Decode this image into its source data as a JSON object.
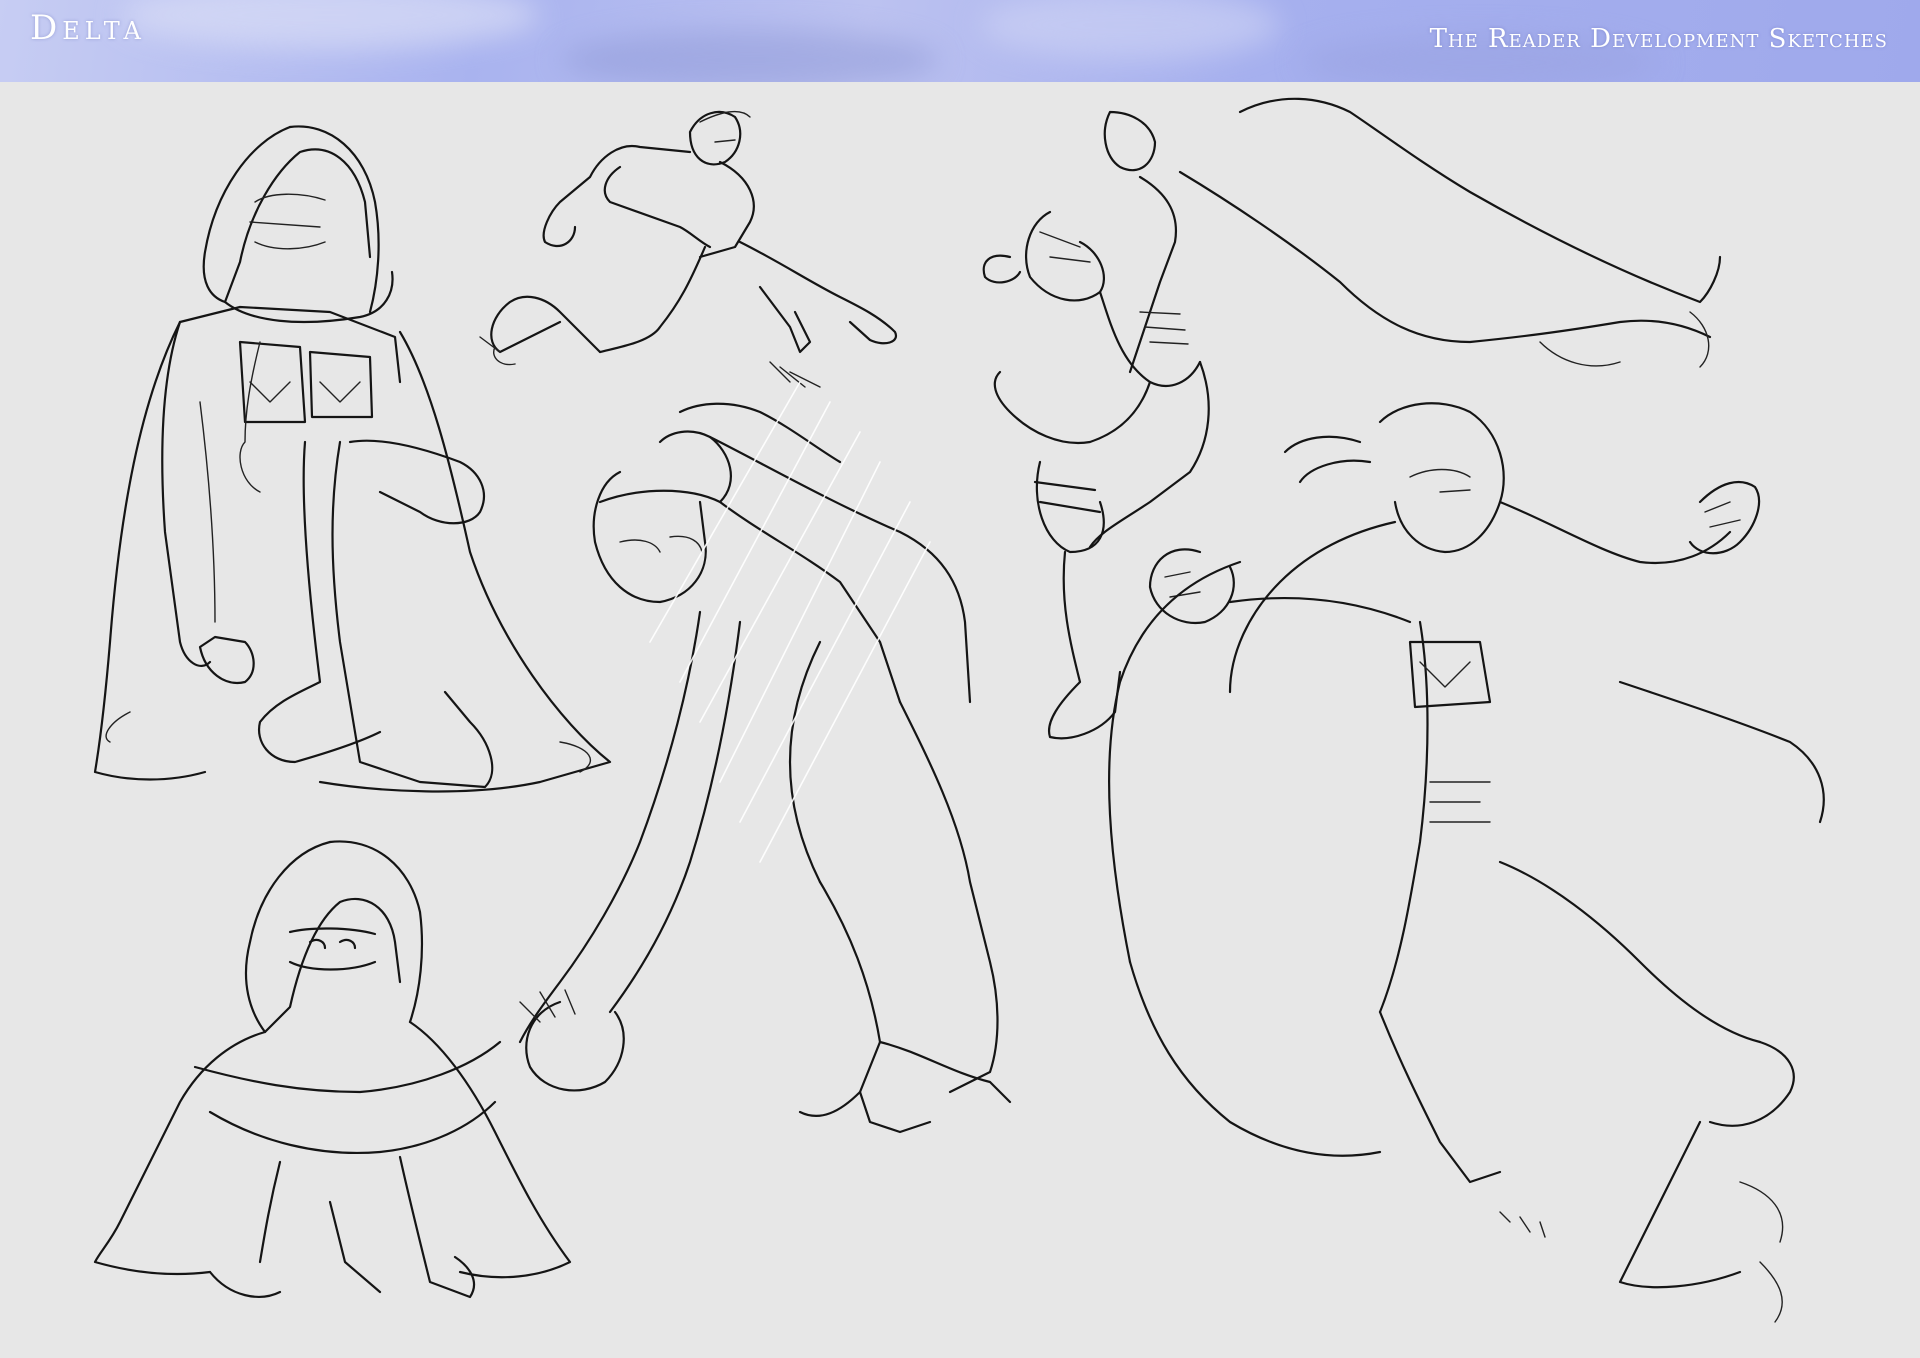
{
  "header": {
    "logo": "Delta",
    "subtitle": "The Reader Development Sketches"
  },
  "colors": {
    "header_sky": "#a9b3ef",
    "paper": "#e7e7e7",
    "ink": "#151515",
    "eye_accent": "#4a5fc0"
  },
  "sketches": [
    {
      "name": "kneeling-hooded-pose"
    },
    {
      "name": "lunging-slide-pose"
    },
    {
      "name": "leaping-cape-pose"
    },
    {
      "name": "crouching-hooded-cloak-pose"
    },
    {
      "name": "ground-strike-pose"
    },
    {
      "name": "punching-cape-pose"
    }
  ]
}
